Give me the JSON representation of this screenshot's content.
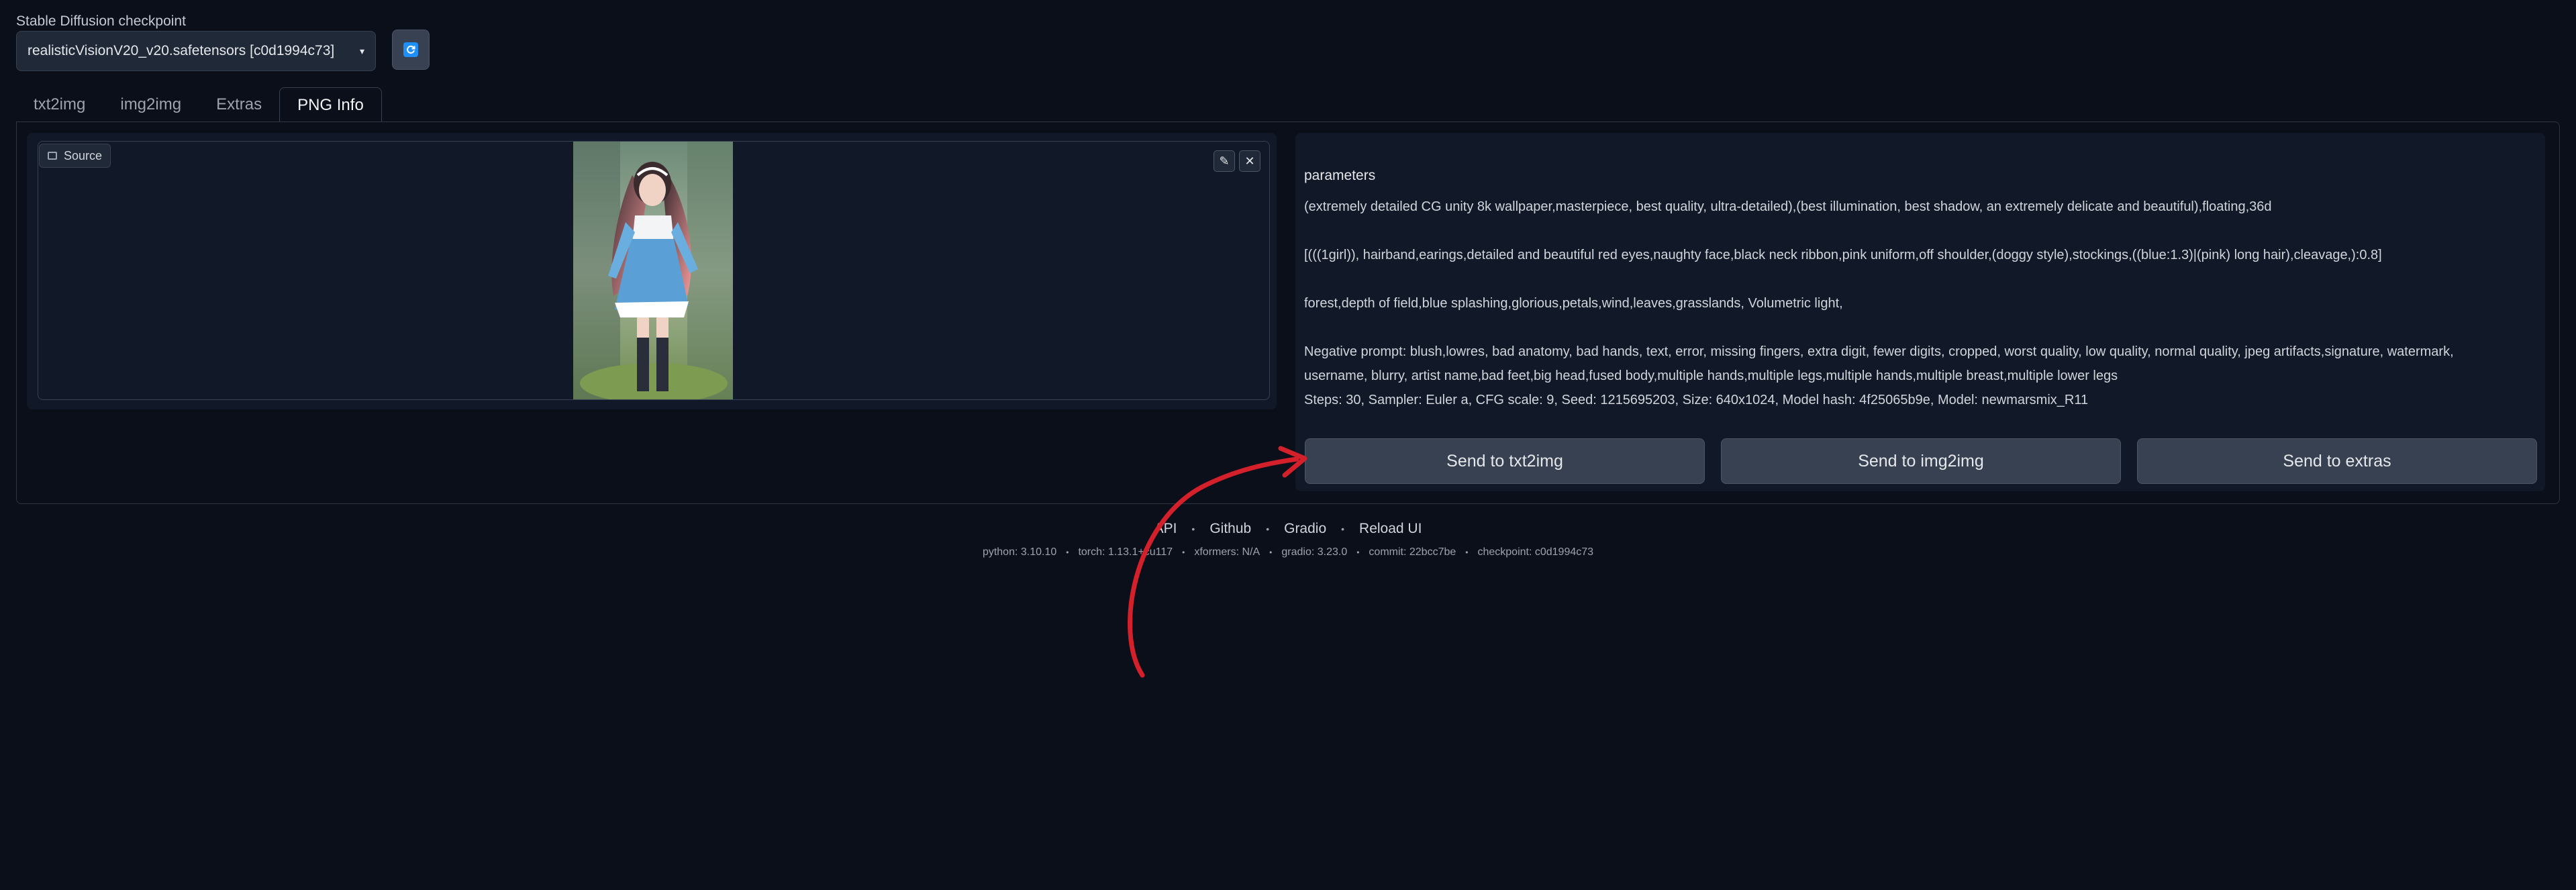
{
  "checkpoint": {
    "label": "Stable Diffusion checkpoint",
    "selected": "realisticVisionV20_v20.safetensors [c0d1994c73]"
  },
  "tabs": [
    {
      "label": "txt2img",
      "active": false
    },
    {
      "label": "img2img",
      "active": false
    },
    {
      "label": "Extras",
      "active": false
    },
    {
      "label": "PNG Info",
      "active": true
    }
  ],
  "image_panel": {
    "source_label": "Source"
  },
  "parameters": {
    "heading": "parameters",
    "prompt_line1": "(extremely detailed CG unity 8k wallpaper,masterpiece, best quality, ultra-detailed),(best illumination, best shadow, an extremely delicate and beautiful),floating,36d",
    "prompt_line2": "[(((1girl)), hairband,earings,detailed and beautiful red eyes,naughty face,black neck ribbon,pink uniform,off shoulder,(doggy style),stockings,((blue:1.3)|(pink) long hair),cleavage,):0.8]",
    "prompt_line3": "forest,depth of field,blue splashing,glorious,petals,wind,leaves,grasslands, Volumetric light,",
    "negative_line1": "Negative prompt: blush,lowres, bad anatomy, bad hands, text, error, missing fingers, extra digit, fewer digits, cropped, worst quality, low quality, normal quality, jpeg artifacts,signature, watermark,",
    "negative_line2": "username, blurry, artist name,bad feet,big head,fused body,multiple hands,multiple legs,multiple hands,multiple breast,multiple lower legs",
    "settings": "Steps: 30, Sampler: Euler a, CFG scale: 9, Seed: 1215695203, Size: 640x1024, Model hash: 4f25065b9e, Model: newmarsmix_R11"
  },
  "send_buttons": {
    "txt2img": "Send to txt2img",
    "img2img": "Send to img2img",
    "extras": "Send to extras"
  },
  "footer": {
    "links": [
      "API",
      "Github",
      "Gradio",
      "Reload UI"
    ],
    "separator": "•",
    "versions": [
      "python: 3.10.10",
      "torch: 1.13.1+cu117",
      "xformers: N/A",
      "gradio: 3.23.0",
      "commit: 22bcc7be",
      "checkpoint: c0d1994c73"
    ]
  },
  "colors": {
    "background": "#0b0f19",
    "panel": "#111827",
    "button": "#374151",
    "accent": "#1d8ff7",
    "annotation_arrow": "#d3202a"
  }
}
